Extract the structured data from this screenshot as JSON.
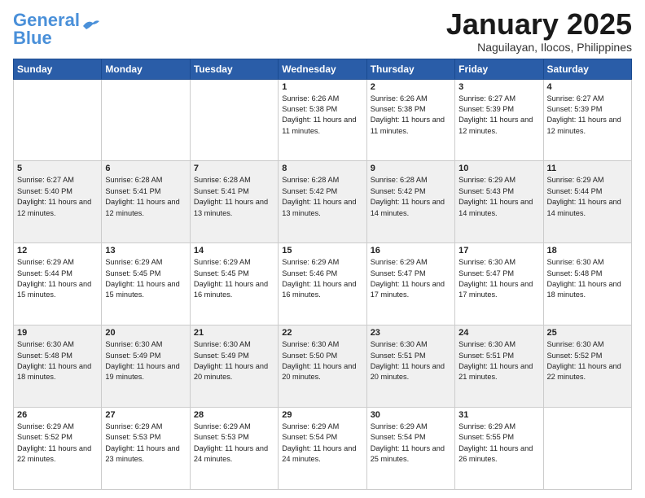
{
  "header": {
    "logo_line1": "General",
    "logo_line2": "Blue",
    "month_title": "January 2025",
    "location": "Naguilayan, Ilocos, Philippines"
  },
  "weekdays": [
    "Sunday",
    "Monday",
    "Tuesday",
    "Wednesday",
    "Thursday",
    "Friday",
    "Saturday"
  ],
  "weeks": [
    [
      {
        "day": "",
        "sunrise": "",
        "sunset": "",
        "daylight": ""
      },
      {
        "day": "",
        "sunrise": "",
        "sunset": "",
        "daylight": ""
      },
      {
        "day": "",
        "sunrise": "",
        "sunset": "",
        "daylight": ""
      },
      {
        "day": "1",
        "sunrise": "Sunrise: 6:26 AM",
        "sunset": "Sunset: 5:38 PM",
        "daylight": "Daylight: 11 hours and 11 minutes."
      },
      {
        "day": "2",
        "sunrise": "Sunrise: 6:26 AM",
        "sunset": "Sunset: 5:38 PM",
        "daylight": "Daylight: 11 hours and 11 minutes."
      },
      {
        "day": "3",
        "sunrise": "Sunrise: 6:27 AM",
        "sunset": "Sunset: 5:39 PM",
        "daylight": "Daylight: 11 hours and 12 minutes."
      },
      {
        "day": "4",
        "sunrise": "Sunrise: 6:27 AM",
        "sunset": "Sunset: 5:39 PM",
        "daylight": "Daylight: 11 hours and 12 minutes."
      }
    ],
    [
      {
        "day": "5",
        "sunrise": "Sunrise: 6:27 AM",
        "sunset": "Sunset: 5:40 PM",
        "daylight": "Daylight: 11 hours and 12 minutes."
      },
      {
        "day": "6",
        "sunrise": "Sunrise: 6:28 AM",
        "sunset": "Sunset: 5:41 PM",
        "daylight": "Daylight: 11 hours and 12 minutes."
      },
      {
        "day": "7",
        "sunrise": "Sunrise: 6:28 AM",
        "sunset": "Sunset: 5:41 PM",
        "daylight": "Daylight: 11 hours and 13 minutes."
      },
      {
        "day": "8",
        "sunrise": "Sunrise: 6:28 AM",
        "sunset": "Sunset: 5:42 PM",
        "daylight": "Daylight: 11 hours and 13 minutes."
      },
      {
        "day": "9",
        "sunrise": "Sunrise: 6:28 AM",
        "sunset": "Sunset: 5:42 PM",
        "daylight": "Daylight: 11 hours and 14 minutes."
      },
      {
        "day": "10",
        "sunrise": "Sunrise: 6:29 AM",
        "sunset": "Sunset: 5:43 PM",
        "daylight": "Daylight: 11 hours and 14 minutes."
      },
      {
        "day": "11",
        "sunrise": "Sunrise: 6:29 AM",
        "sunset": "Sunset: 5:44 PM",
        "daylight": "Daylight: 11 hours and 14 minutes."
      }
    ],
    [
      {
        "day": "12",
        "sunrise": "Sunrise: 6:29 AM",
        "sunset": "Sunset: 5:44 PM",
        "daylight": "Daylight: 11 hours and 15 minutes."
      },
      {
        "day": "13",
        "sunrise": "Sunrise: 6:29 AM",
        "sunset": "Sunset: 5:45 PM",
        "daylight": "Daylight: 11 hours and 15 minutes."
      },
      {
        "day": "14",
        "sunrise": "Sunrise: 6:29 AM",
        "sunset": "Sunset: 5:45 PM",
        "daylight": "Daylight: 11 hours and 16 minutes."
      },
      {
        "day": "15",
        "sunrise": "Sunrise: 6:29 AM",
        "sunset": "Sunset: 5:46 PM",
        "daylight": "Daylight: 11 hours and 16 minutes."
      },
      {
        "day": "16",
        "sunrise": "Sunrise: 6:29 AM",
        "sunset": "Sunset: 5:47 PM",
        "daylight": "Daylight: 11 hours and 17 minutes."
      },
      {
        "day": "17",
        "sunrise": "Sunrise: 6:30 AM",
        "sunset": "Sunset: 5:47 PM",
        "daylight": "Daylight: 11 hours and 17 minutes."
      },
      {
        "day": "18",
        "sunrise": "Sunrise: 6:30 AM",
        "sunset": "Sunset: 5:48 PM",
        "daylight": "Daylight: 11 hours and 18 minutes."
      }
    ],
    [
      {
        "day": "19",
        "sunrise": "Sunrise: 6:30 AM",
        "sunset": "Sunset: 5:48 PM",
        "daylight": "Daylight: 11 hours and 18 minutes."
      },
      {
        "day": "20",
        "sunrise": "Sunrise: 6:30 AM",
        "sunset": "Sunset: 5:49 PM",
        "daylight": "Daylight: 11 hours and 19 minutes."
      },
      {
        "day": "21",
        "sunrise": "Sunrise: 6:30 AM",
        "sunset": "Sunset: 5:49 PM",
        "daylight": "Daylight: 11 hours and 20 minutes."
      },
      {
        "day": "22",
        "sunrise": "Sunrise: 6:30 AM",
        "sunset": "Sunset: 5:50 PM",
        "daylight": "Daylight: 11 hours and 20 minutes."
      },
      {
        "day": "23",
        "sunrise": "Sunrise: 6:30 AM",
        "sunset": "Sunset: 5:51 PM",
        "daylight": "Daylight: 11 hours and 20 minutes."
      },
      {
        "day": "24",
        "sunrise": "Sunrise: 6:30 AM",
        "sunset": "Sunset: 5:51 PM",
        "daylight": "Daylight: 11 hours and 21 minutes."
      },
      {
        "day": "25",
        "sunrise": "Sunrise: 6:30 AM",
        "sunset": "Sunset: 5:52 PM",
        "daylight": "Daylight: 11 hours and 22 minutes."
      }
    ],
    [
      {
        "day": "26",
        "sunrise": "Sunrise: 6:29 AM",
        "sunset": "Sunset: 5:52 PM",
        "daylight": "Daylight: 11 hours and 22 minutes."
      },
      {
        "day": "27",
        "sunrise": "Sunrise: 6:29 AM",
        "sunset": "Sunset: 5:53 PM",
        "daylight": "Daylight: 11 hours and 23 minutes."
      },
      {
        "day": "28",
        "sunrise": "Sunrise: 6:29 AM",
        "sunset": "Sunset: 5:53 PM",
        "daylight": "Daylight: 11 hours and 24 minutes."
      },
      {
        "day": "29",
        "sunrise": "Sunrise: 6:29 AM",
        "sunset": "Sunset: 5:54 PM",
        "daylight": "Daylight: 11 hours and 24 minutes."
      },
      {
        "day": "30",
        "sunrise": "Sunrise: 6:29 AM",
        "sunset": "Sunset: 5:54 PM",
        "daylight": "Daylight: 11 hours and 25 minutes."
      },
      {
        "day": "31",
        "sunrise": "Sunrise: 6:29 AM",
        "sunset": "Sunset: 5:55 PM",
        "daylight": "Daylight: 11 hours and 26 minutes."
      },
      {
        "day": "",
        "sunrise": "",
        "sunset": "",
        "daylight": ""
      }
    ]
  ]
}
